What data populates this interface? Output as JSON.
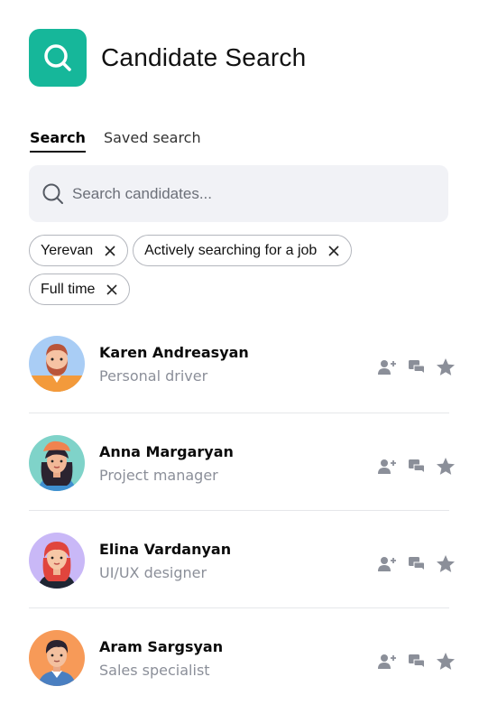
{
  "header": {
    "title": "Candidate Search",
    "icon": "search-icon",
    "accent": "#16b79a"
  },
  "tabs": [
    {
      "label": "Search",
      "active": true
    },
    {
      "label": "Saved search",
      "active": false
    }
  ],
  "search": {
    "placeholder": "Search candidates...",
    "value": ""
  },
  "filters": [
    {
      "label": "Yerevan"
    },
    {
      "label": "Actively searching for a job"
    },
    {
      "label": "Full time"
    }
  ],
  "candidates": [
    {
      "name": "Karen Andreasyan",
      "role": "Personal driver",
      "avatar_bg": "#a9cdf5"
    },
    {
      "name": "Anna Margaryan",
      "role": "Project manager",
      "avatar_bg": "#7fd3c9"
    },
    {
      "name": "Elina Vardanyan",
      "role": "UI/UX designer",
      "avatar_bg": "#c9b8f7"
    },
    {
      "name": "Aram Sargsyan",
      "role": "Sales specialist",
      "avatar_bg": "#f79a58"
    }
  ],
  "actions": [
    "add-user-icon",
    "chat-icon",
    "star-icon"
  ]
}
